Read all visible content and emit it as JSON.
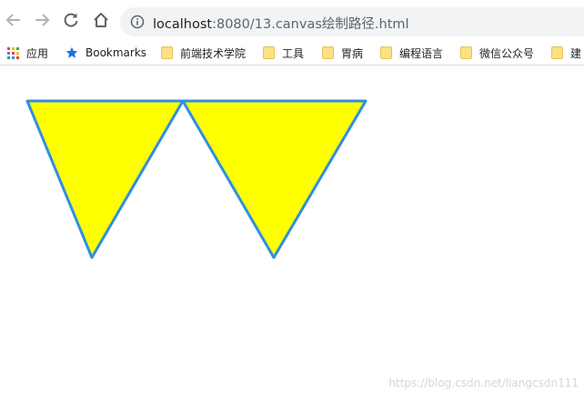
{
  "browser": {
    "url_host": "localhost",
    "url_path": ":8080/13.canvas绘制路径.html"
  },
  "bookmarks_bar": {
    "apps_label": "应用",
    "items": [
      {
        "label": "Bookmarks",
        "icon": "star-icon"
      },
      {
        "label": "前端技术学院",
        "icon": "folder-icon"
      },
      {
        "label": "工具",
        "icon": "folder-icon"
      },
      {
        "label": "胃病",
        "icon": "folder-icon"
      },
      {
        "label": "编程语言",
        "icon": "folder-icon"
      },
      {
        "label": "微信公众号",
        "icon": "folder-icon"
      },
      {
        "label": "建",
        "icon": "folder-icon"
      }
    ]
  },
  "canvas": {
    "fill_color": "#ffff00",
    "stroke_color": "#2f8fe0",
    "shapes": [
      "triangle",
      "triangle"
    ]
  },
  "watermark": "https://blog.csdn.net/liangcsdn111"
}
